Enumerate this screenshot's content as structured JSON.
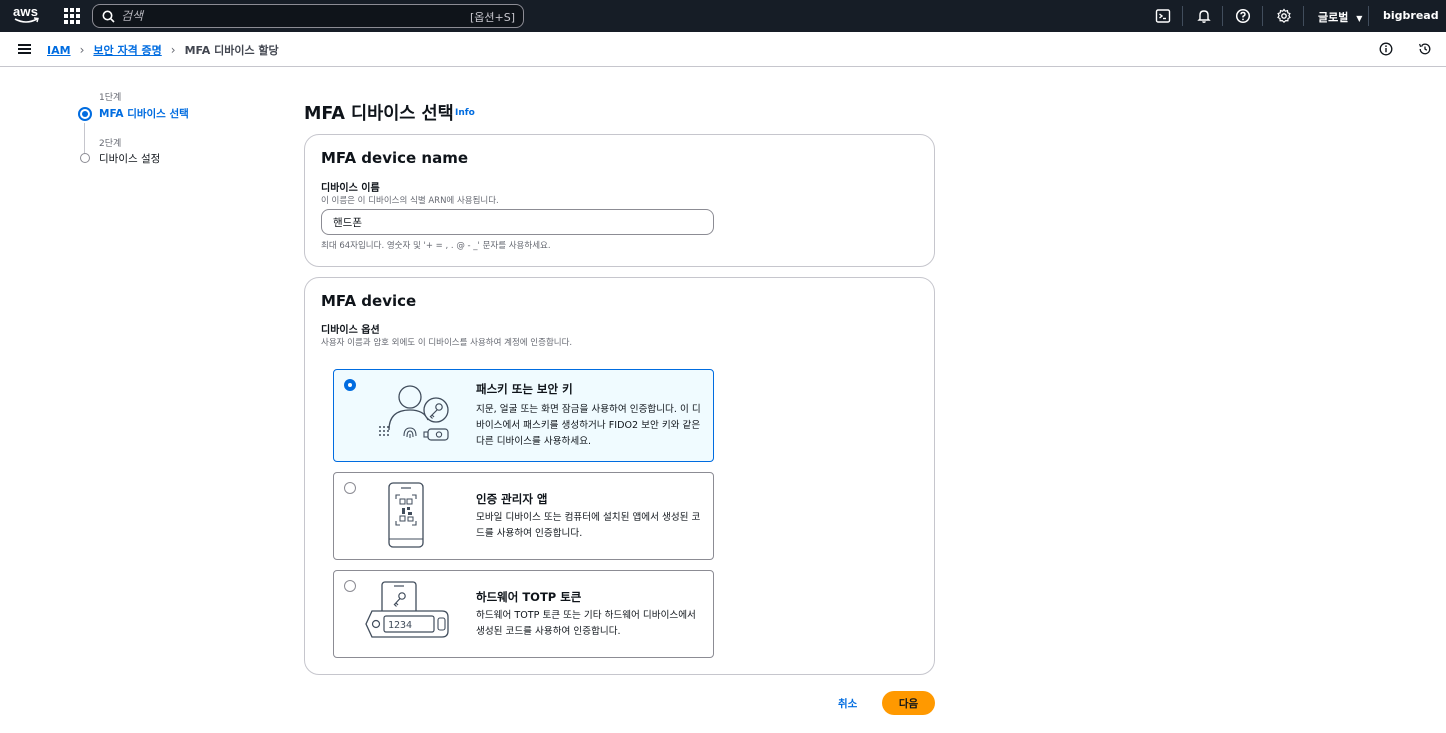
{
  "topnav": {
    "logo_text": "aws",
    "search_placeholder": "검색",
    "search_shortcut": "[옵션+S]",
    "region": "글로벌",
    "account": "bigbread",
    "icons": [
      "grid-icon",
      "search-icon",
      "cloudshell-icon",
      "bell-icon",
      "help-icon",
      "gear-icon"
    ]
  },
  "breadcrumb": {
    "items": [
      "IAM",
      "보안 자격 증명",
      "MFA 디바이스 할당"
    ]
  },
  "steps": [
    {
      "number": "1단계",
      "label": "MFA 디바이스 선택",
      "active": true
    },
    {
      "number": "2단계",
      "label": "디바이스 설정",
      "active": false
    }
  ],
  "page": {
    "title": "MFA 디바이스 선택",
    "info_link": "Info"
  },
  "name_card": {
    "title": "MFA device name",
    "field_label": "디바이스 이름",
    "field_desc": "이 이름은 이 디바이스의 식별 ARN에 사용됩니다.",
    "field_value": "핸드폰",
    "constraint": "최대 64자입니다. 영숫자 및 '+ = , . @ - _' 문자를 사용하세요."
  },
  "device_card": {
    "title": "MFA device",
    "field_label": "디바이스 옵션",
    "field_desc": "사용자 이름과 암호 외에도 이 디바이스를 사용하여 계정에 인증합니다.",
    "options": [
      {
        "title": "패스키 또는 보안 키",
        "description": "지문, 얼굴 또는 화면 잠금을 사용하여 인증합니다. 이 디바이스에서 패스키를 생성하거나 FIDO2 보안 키와 같은 다른 디바이스를 사용하세요.",
        "selected": true,
        "icon": "passkey-illustration"
      },
      {
        "title": "인증 관리자 앱",
        "description": "모바일 디바이스 또는 컴퓨터에 설치된 앱에서 생성된 코드를 사용하여 인증합니다.",
        "selected": false,
        "icon": "authenticator-app-illustration"
      },
      {
        "title": "하드웨어 TOTP 토큰",
        "description": "하드웨어 TOTP 토큰 또는 기타 하드웨어 디바이스에서 생성된 코드를 사용하여 인증합니다.",
        "selected": false,
        "icon": "hardware-token-illustration",
        "token_display": "1234"
      }
    ]
  },
  "actions": {
    "cancel": "취소",
    "next": "다음"
  },
  "colors": {
    "nav_bg": "#161d26",
    "accent": "#006ce0",
    "primary_button": "#ff9900",
    "selected_bg": "#f0fbff"
  }
}
